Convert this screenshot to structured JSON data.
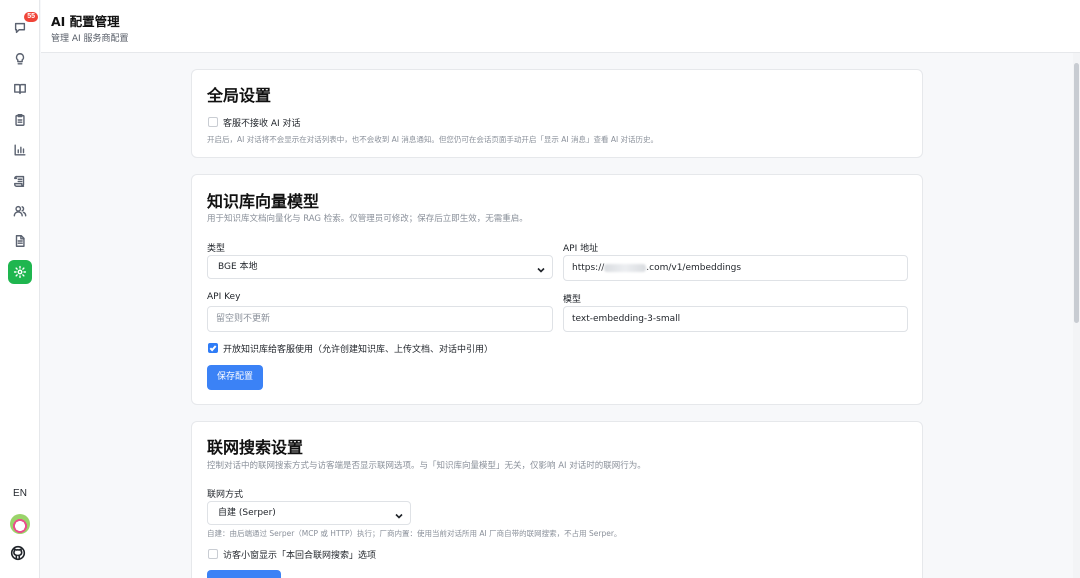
{
  "sidebar": {
    "items": [
      {
        "icon": "chat-icon",
        "badge": "55"
      },
      {
        "icon": "lightbulb-icon"
      },
      {
        "icon": "book-icon"
      },
      {
        "icon": "clipboard-icon"
      },
      {
        "icon": "bar-chart-icon"
      },
      {
        "icon": "scroll-icon"
      },
      {
        "icon": "users-icon"
      },
      {
        "icon": "document-icon"
      },
      {
        "icon": "settings-icon",
        "active": true
      }
    ],
    "language": "EN"
  },
  "header": {
    "title": "AI 配置管理",
    "subtitle": "管理 AI 服务商配置"
  },
  "global_settings": {
    "title": "全局设置",
    "no_ai_checkbox_label": "客服不接收 AI 对话",
    "no_ai_checked": false,
    "description": "开启后，AI 对话将不会显示在对话列表中，也不会收到 AI 消息通知。但您仍可在会话页面手动开启「显示 AI 消息」查看 AI 对话历史。"
  },
  "knowledge": {
    "title": "知识库向量模型",
    "description": "用于知识库文档向量化与 RAG 检索。仅管理员可修改；保存后立即生效，无需重启。",
    "type_label": "类型",
    "type_value": "BGE 本地",
    "api_url_label": "API 地址",
    "api_url_prefix": "https://",
    "api_url_suffix": ".com/v1/embeddings",
    "api_key_label": "API Key",
    "api_key_placeholder": "留空则不更新",
    "model_label": "模型",
    "model_value": "text-embedding-3-small",
    "open_checkbox_label": "开放知识库给客服使用（允许创建知识库、上传文档、对话中引用）",
    "open_checked": true,
    "save_button": "保存配置"
  },
  "web_search": {
    "title": "联网搜索设置",
    "description": "控制对话中的联网搜索方式与访客端是否显示联网选项。与「知识库向量模型」无关，仅影响 AI 对话时的联网行为。",
    "mode_label": "联网方式",
    "mode_value": "自建 (Serper)",
    "mode_hint": "自建：由后端通过 Serper（MCP 或 HTTP）执行；厂商内置：使用当前对话所用 AI 厂商自带的联网搜索，不占用 Serper。",
    "visitor_checkbox_label": "访客小窗显示「本回合联网搜索」选项",
    "visitor_checked": false
  },
  "colors": {
    "accent": "#3b82f6",
    "active_nav": "#1fb64f",
    "badge": "#f04438"
  }
}
